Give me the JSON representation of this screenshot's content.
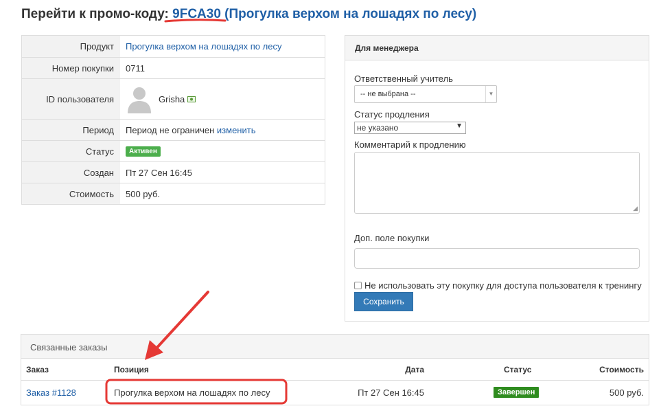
{
  "title": {
    "prefix": "Перейти к промо-коду:",
    "code": "9FCA30",
    "product": "(Прогулка верхом на лошадях по лесу)"
  },
  "info": {
    "product_label": "Продукт",
    "product_value": "Прогулка верхом на лошадях по лесу",
    "purchase_no_label": "Номер покупки",
    "purchase_no_value": "0711",
    "user_id_label": "ID пользователя",
    "user_name": "Grisha",
    "period_label": "Период",
    "period_value": "Период не ограничен",
    "period_change": "изменить",
    "status_label": "Статус",
    "status_value": "Активен",
    "created_label": "Создан",
    "created_value": "Пт 27 Сен 16:45",
    "cost_label": "Стоимость",
    "cost_value": "500 руб."
  },
  "manager": {
    "header": "Для менеджера",
    "teacher_label": "Ответственный учитель",
    "teacher_value": "-- не выбрана --",
    "renewal_status_label": "Статус продления",
    "renewal_status_value": "не указано",
    "renewal_comment_label": "Комментарий к продлению",
    "extra_field_label": "Доп. поле покупки",
    "no_access_label": "Не использовать эту покупку для доступа пользователя к тренингу",
    "save_label": "Сохранить"
  },
  "orders": {
    "header": "Связанные заказы",
    "columns": [
      "Заказ",
      "Позиция",
      "Дата",
      "Статус",
      "Стоимость"
    ],
    "rows": [
      {
        "order": "Заказ #1128",
        "position": "Прогулка верхом на лошадях по лесу",
        "date": "Пт 27 Сен 16:45",
        "status": "Завершен",
        "cost": "500 руб."
      }
    ]
  },
  "colors": {
    "link": "#1f5fa6",
    "active_badge": "#4cae4c",
    "done_badge": "#2f8c1f",
    "primary_button": "#337ab7",
    "annotation_red": "#e53935"
  }
}
